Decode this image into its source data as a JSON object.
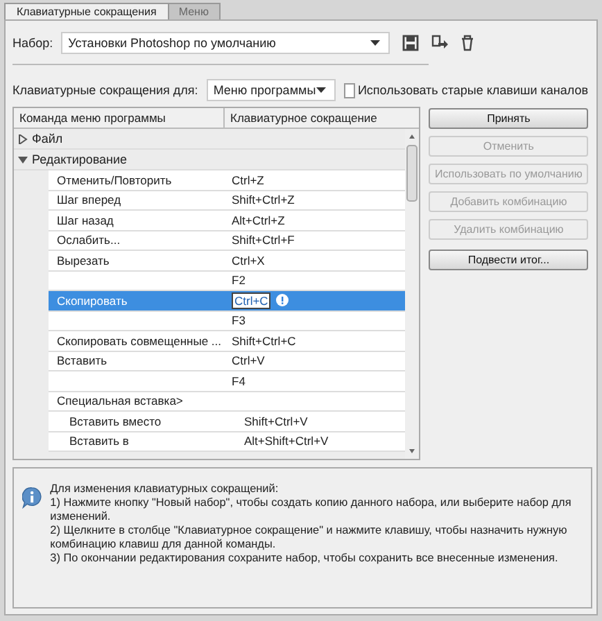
{
  "tabs": [
    {
      "label": "Клавиатурные сокращения",
      "selected": true
    },
    {
      "label": "Меню",
      "selected": false
    }
  ],
  "set": {
    "label": "Набор:",
    "value": "Установки Photoshop по умолчанию"
  },
  "shortcuts_for": {
    "label": "Клавиатурные сокращения для:",
    "value": "Меню программы"
  },
  "legacy_channels": {
    "label": "Использовать старые клавиши каналов",
    "checked": false
  },
  "table": {
    "columns": [
      "Команда меню программы",
      "Клавиатурное сокращение"
    ],
    "groups": [
      {
        "name": "Файл",
        "expanded": false
      },
      {
        "name": "Редактирование",
        "expanded": true,
        "children": [
          {
            "name": "Отменить/Повторить",
            "shortcuts": [
              "Ctrl+Z"
            ],
            "selected": false
          },
          {
            "name": "Шаг вперед",
            "shortcuts": [
              "Shift+Ctrl+Z"
            ],
            "selected": false
          },
          {
            "name": "Шаг назад",
            "shortcuts": [
              "Alt+Ctrl+Z"
            ],
            "selected": false
          },
          {
            "name": "Ослабить...",
            "shortcuts": [
              "Shift+Ctrl+F"
            ],
            "selected": false
          },
          {
            "name": "Вырезать",
            "shortcuts": [
              "Ctrl+X",
              "F2"
            ],
            "selected": false
          },
          {
            "name": "Скопировать",
            "shortcuts": [
              "Ctrl+C",
              "F3"
            ],
            "selected": true
          },
          {
            "name": "Скопировать совмещенные ...",
            "shortcuts": [
              "Shift+Ctrl+C"
            ],
            "selected": false
          },
          {
            "name": "Вставить",
            "shortcuts": [
              "Ctrl+V",
              "F4"
            ],
            "selected": false
          },
          {
            "name": "Специальная вставка>",
            "selected": false,
            "children": [
              {
                "name": "Вставить вместо",
                "shortcuts": [
                  "Shift+Ctrl+V"
                ],
                "selected": false
              },
              {
                "name": "Вставить в",
                "shortcuts": [
                  "Alt+Shift+Ctrl+V"
                ],
                "selected": false
              }
            ]
          }
        ]
      }
    ]
  },
  "buttons": [
    {
      "label": "Принять",
      "disabled": false
    },
    {
      "label": "Отменить",
      "disabled": true
    },
    {
      "label": "Использовать по умолчанию",
      "disabled": true
    },
    {
      "label": "Добавить комбинацию",
      "disabled": true
    },
    {
      "label": "Удалить комбинацию",
      "disabled": true
    },
    {
      "label": "Подвести итог...",
      "disabled": false
    }
  ],
  "info": {
    "lines": [
      "Для изменения клавиатурных сокращений:",
      "1) Нажмите кнопку \"Новый набор\", чтобы создать копию данного набора, или выберите набор для изменений.",
      "2) Щелкните в столбце \"Клавиатурное сокращение\" и нажмите клавишу, чтобы назначить нужную комбинацию клавиш для данной команды.",
      "3) По окончании редактирования сохраните набор, чтобы сохранить все внесенные изменения."
    ]
  }
}
